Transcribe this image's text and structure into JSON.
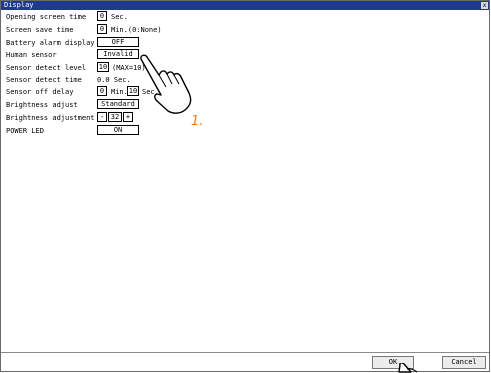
{
  "window": {
    "title": "Display",
    "close_glyph": "x"
  },
  "settings": {
    "opening_screen_time": {
      "label": "Opening screen time",
      "value": "0",
      "unit": "Sec."
    },
    "screen_save_time": {
      "label": "Screen save time",
      "value": "0",
      "unit": "Min.(0:None)"
    },
    "battery_alarm_display": {
      "label": "Battery alarm display",
      "value": "OFF"
    },
    "human_sensor": {
      "label": "Human sensor",
      "value": "Invalid"
    },
    "sensor_detect_level": {
      "label": "Sensor detect level",
      "value": "10",
      "unit": "(MAX=10)"
    },
    "sensor_detect_time": {
      "label": "Sensor detect time",
      "value": "0.0 Sec."
    },
    "sensor_off_delay": {
      "label": "Sensor off delay",
      "min_value": "0",
      "min_unit": "Min.",
      "sec_value": "10",
      "sec_unit": "Sec."
    },
    "brightness_adjust": {
      "label": "Brightness adjust",
      "value": "Standard"
    },
    "brightness_adjustment": {
      "label": "Brightness adjustment",
      "minus": "-",
      "value": "32",
      "plus": "+"
    },
    "power_led": {
      "label": "POWER LED",
      "value": "ON"
    }
  },
  "footer": {
    "ok_label": "OK",
    "cancel_label": "Cancel"
  },
  "annotation": {
    "step_label": "1."
  },
  "icons": {
    "pointer": "hand-pointer-icon"
  }
}
